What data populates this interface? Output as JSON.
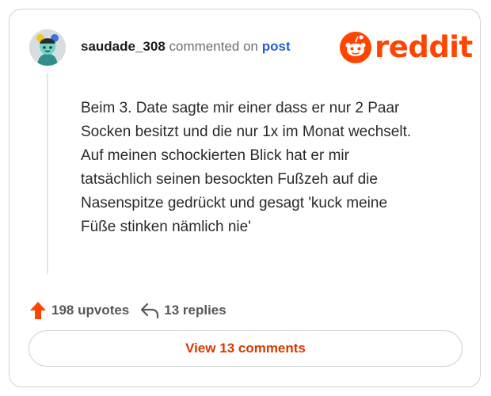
{
  "header": {
    "username": "saudade_308",
    "action_text": "commented on",
    "post_link": "post"
  },
  "brand": {
    "wordmark": "reddit",
    "color": "#ff4500"
  },
  "comment": {
    "lines": [
      "Beim 3. Date sagte mir einer dass er nur 2 Paar",
      "Socken besitzt und die nur 1x im Monat wechselt.",
      "Auf meinen schockierten Blick hat er mir",
      "tatsächlich seinen besockten Fußzeh auf die",
      "Nasenspitze gedrückt und gesagt 'kuck meine",
      "Füße stinken nämlich nie'"
    ]
  },
  "stats": {
    "upvotes_label": "198 upvotes",
    "upvote_icon": "upvote-arrow-icon",
    "replies_label": "13 replies",
    "replies_icon": "reply-arrow-icon"
  },
  "actions": {
    "view_comments_label": "View 13 comments"
  },
  "colors": {
    "accent": "#ff4500",
    "link": "#1f62d1",
    "button_text": "#d93a00"
  }
}
